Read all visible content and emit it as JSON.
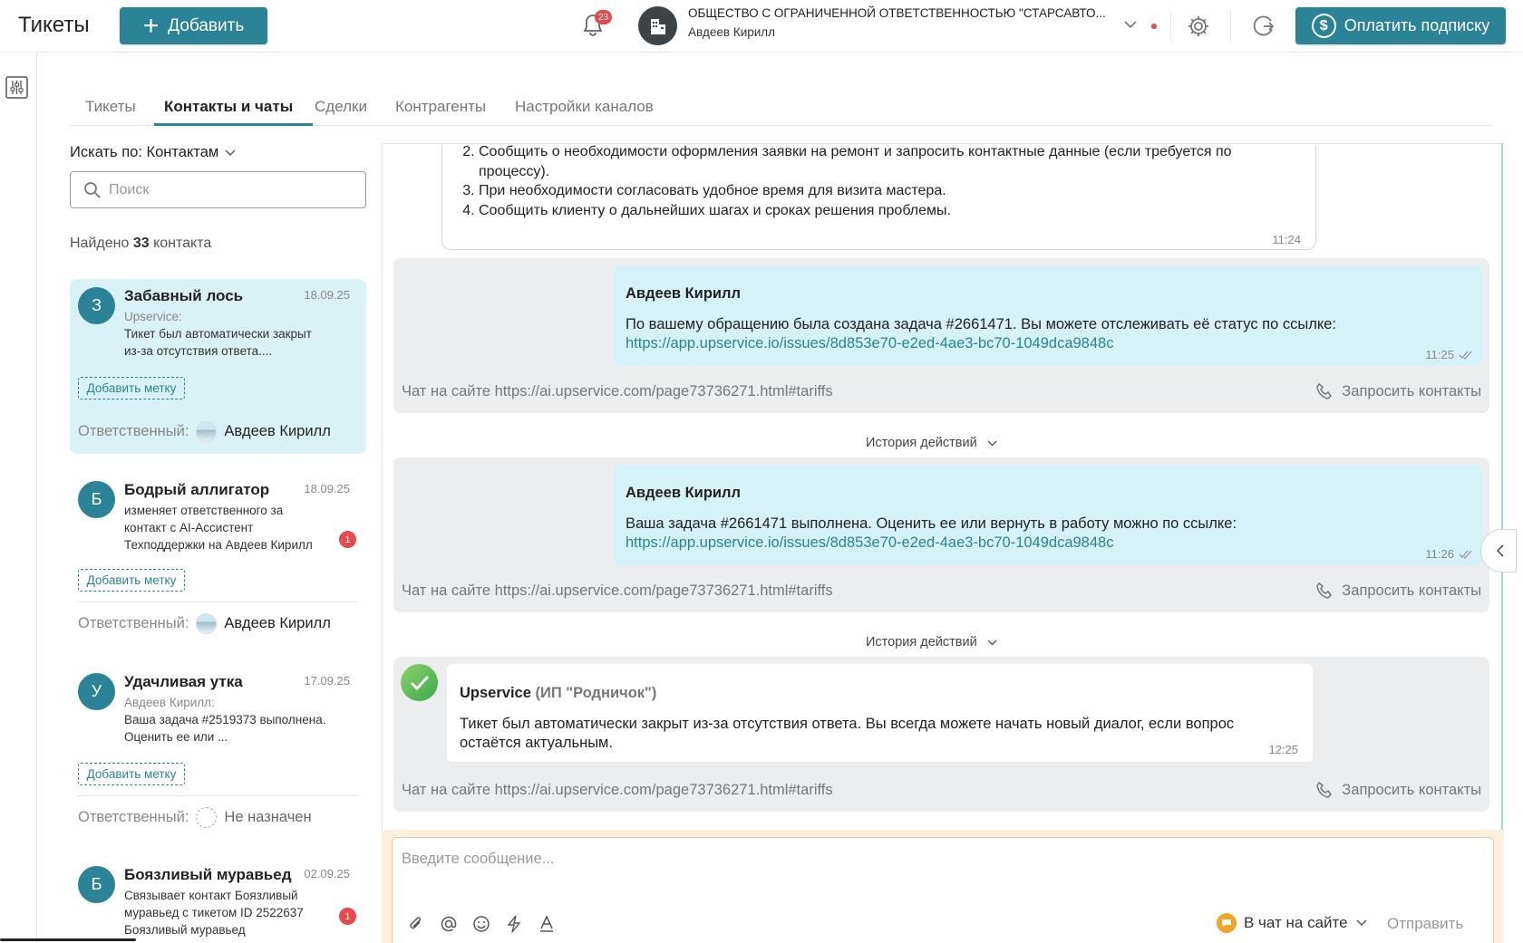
{
  "header": {
    "title": "Тикеты",
    "add_label": "Добавить",
    "notifications_count": "23",
    "org_name": "ОБЩЕСТВО С ОГРАНИЧЕННОЙ ОТВЕТСТВЕННОСТЬЮ \"СТАРСАВТО...",
    "org_user": "Авдеев Кирилл",
    "pay_label": "Оплатить подписку"
  },
  "tabs": [
    {
      "label": "Тикеты"
    },
    {
      "label": "Контакты и чаты",
      "active": true
    },
    {
      "label": "Сделки"
    },
    {
      "label": "Контрагенты"
    },
    {
      "label": "Настройки каналов"
    }
  ],
  "sidebar": {
    "search_by_label": "Искать по: Контактам",
    "search_placeholder": "Поиск",
    "found_prefix": "Найдено",
    "found_count": "33",
    "found_suffix": "контакта",
    "tag_label": "Добавить метку",
    "resp_label": "Ответственный:",
    "contacts": [
      {
        "initial": "З",
        "name": "Забавный лось",
        "date": "18.09.25",
        "who": "Upservice:",
        "snippet": "Тикет был автоматически закрыт из-за отсутствия ответа....",
        "responsible": "Авдеев Кирилл",
        "selected": true
      },
      {
        "initial": "Б",
        "name": "Бодрый аллигатор",
        "date": "18.09.25",
        "who": "",
        "snippet": "изменяет ответственного за контакт с AI-Ассистент Техподдержки на Авдеев Кирилл",
        "badge": "1",
        "responsible": "Авдеев Кирилл"
      },
      {
        "initial": "У",
        "name": "Удачливая утка",
        "date": "17.09.25",
        "who": "Авдеев Кирилл:",
        "snippet": "Ваша задача #2519373 выполнена. Оценить ее или ...",
        "responsible": "Не назначен"
      },
      {
        "initial": "Б",
        "name": "Боязливый муравьед",
        "date": "02.09.25",
        "who": "",
        "snippet": "Связывает контакт Боязливый муравьед с тикетом ID 2522637 Боязливый муравьед",
        "badge": "1"
      }
    ]
  },
  "chat": {
    "bot_steps": [
      "Сообщить о необходимости оформления заявки на ремонт и запросить контактные данные (если требуется по процессу).",
      "При необходимости согласовать удобное время для визита мастера.",
      "Сообщить клиенту о дальнейших шагах и сроках решения проблемы."
    ],
    "bot_steps_time": "11:24",
    "source": "Чат на сайте https://ai.upservice.com/page73736271.html#tariffs",
    "request_contacts": "Запросить контакты",
    "history_label": "История действий",
    "messages": [
      {
        "sender": "Авдеев Кирилл",
        "text": "По вашему обращению была создана задача #2661471. Вы можете отслеживать её статус по ссылке:",
        "link": "https://app.upservice.io/issues/8d853e70-e2ed-4ae3-bc70-1049dca9848c",
        "time": "11:25"
      },
      {
        "sender": "Авдеев Кирилл",
        "text": "Ваша задача #2661471 выполнена. Оценить ее или вернуть в работу можно по ссылке:",
        "link": "https://app.upservice.io/issues/8d853e70-e2ed-4ae3-bc70-1049dca9848c",
        "time": "11:26"
      }
    ],
    "system": {
      "name": "Upservice",
      "org": "(ИП \"Родничок\")",
      "text": "Тикет был автоматически закрыт из-за отсутствия ответа. Вы всегда можете начать новый диалог, если вопрос остаётся актуальным.",
      "time": "12:25"
    }
  },
  "composer": {
    "placeholder": "Введите сообщение...",
    "channel": "В чат на сайте",
    "send": "Отправить"
  },
  "colors": {
    "accent": "#2a8396",
    "bubble": "#d5f2f6",
    "badge": "#e5484d"
  }
}
